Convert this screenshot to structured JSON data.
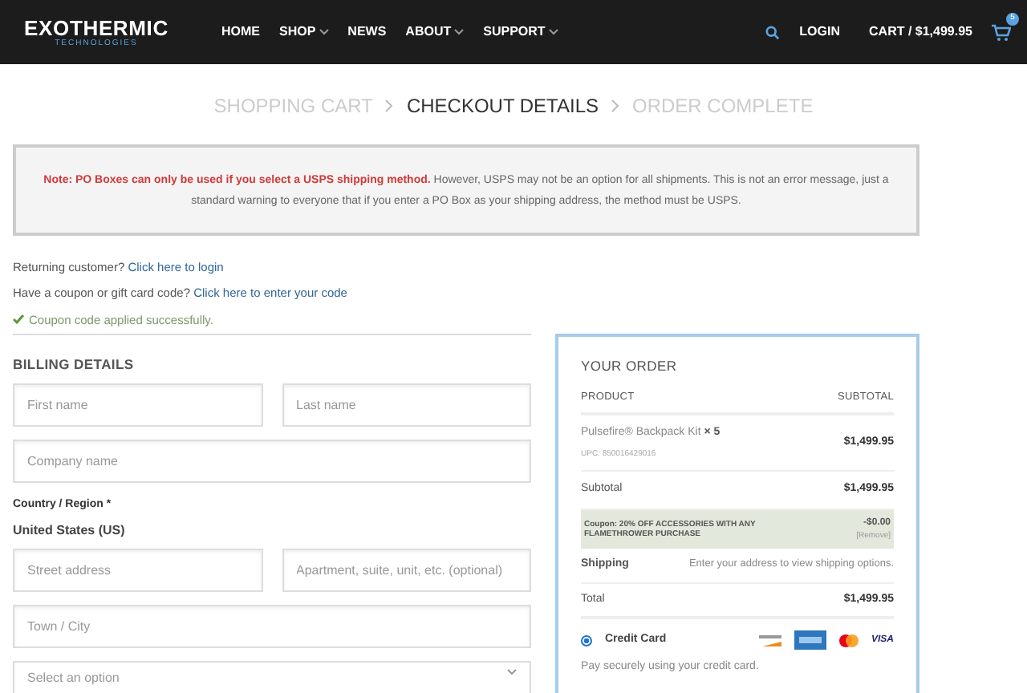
{
  "header": {
    "logo": {
      "main": "EXOTHERMIC",
      "sub": "TECHNOLOGIES"
    },
    "nav": [
      {
        "label": "HOME",
        "dropdown": false
      },
      {
        "label": "SHOP",
        "dropdown": true
      },
      {
        "label": "NEWS",
        "dropdown": false
      },
      {
        "label": "ABOUT",
        "dropdown": true
      },
      {
        "label": "SUPPORT",
        "dropdown": true
      }
    ],
    "login": "LOGIN",
    "cart": "CART / $1,499.95",
    "cart_count": "5"
  },
  "steps": [
    {
      "label": "SHOPPING CART",
      "selected": false
    },
    {
      "label": "CHECKOUT DETAILS",
      "selected": true
    },
    {
      "label": "ORDER COMPLETE",
      "selected": false
    }
  ],
  "notice": {
    "bold": "Note: PO Boxes can only be used if you select a USPS shipping method.",
    "text": "However, USPS may not be an option for all shipments. This is not an error message, just a standard warning to everyone that if you enter a PO Box as your shipping address, the method must be USPS."
  },
  "returning": {
    "text": "Returning customer?",
    "link": "Click here to login"
  },
  "coupon": {
    "text": "Have a coupon or gift card code?",
    "link": "Click here to enter your code"
  },
  "success": "Coupon code applied successfully.",
  "billing": {
    "title": "BILLING DETAILS",
    "rows": [
      [
        {
          "placeholder": "First name"
        },
        {
          "placeholder": "Last name"
        }
      ],
      [
        {
          "placeholder": "Company name"
        }
      ]
    ],
    "country_label": "Country / Region *",
    "country": "United States (US)",
    "rows2": [
      [
        {
          "placeholder": "Street address"
        },
        {
          "placeholder": "Apartment, suite, unit, etc. (optional)"
        }
      ],
      [
        {
          "placeholder": "Town / City"
        }
      ]
    ],
    "select": "Select an option"
  },
  "order": {
    "title": "YOUR ORDER",
    "col_product": "PRODUCT",
    "col_subtotal": "SUBTOTAL",
    "item": {
      "name": "Pulsefire® Backpack Kit",
      "qty": "× 5",
      "upc": "UPC: 850016429016",
      "price": "$1,499.95"
    },
    "subtotal_label": "Subtotal",
    "subtotal": "$1,499.95",
    "coupon_label": "Coupon: 20% OFF ACCESSORIES WITH ANY FLAMETHROWER PURCHASE",
    "coupon_amount": "-$0.00",
    "coupon_remove": "[Remove]",
    "shipping_label": "Shipping",
    "shipping": "Enter your address to view shipping options.",
    "total_label": "Total",
    "total": "$1,499.95",
    "payment": {
      "label": "Credit Card",
      "selected": true,
      "visa": "VISA",
      "note": "Pay securely using your credit card."
    }
  }
}
